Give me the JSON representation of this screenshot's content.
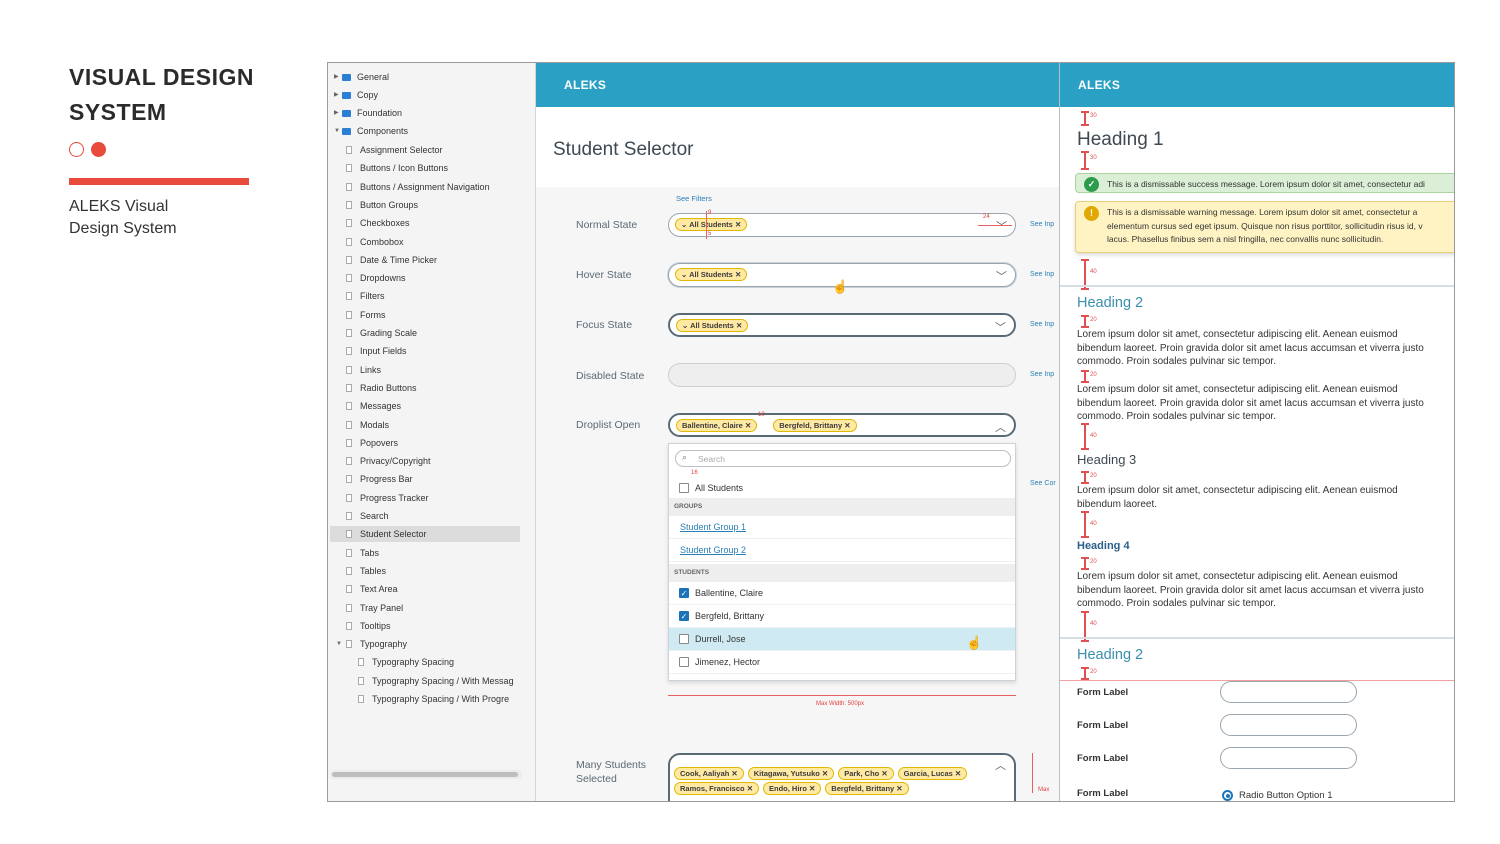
{
  "intro": {
    "title": "VISUAL DESIGN SYSTEM",
    "subtitle_line1": "ALEKS Visual",
    "subtitle_line2": "Design System",
    "accent_color": "#e84a3b"
  },
  "tree": {
    "folders": [
      "General",
      "Copy",
      "Foundation",
      "Components"
    ],
    "components": [
      "Assignment Selector",
      "Buttons / Icon Buttons",
      "Buttons / Assignment Navigation",
      "Button Groups",
      "Checkboxes",
      "Combobox",
      "Date & Time Picker",
      "Dropdowns",
      "Filters",
      "Forms",
      "Grading Scale",
      "Input Fields",
      "Links",
      "Radio Buttons",
      "Messages",
      "Modals",
      "Popovers",
      "Privacy/Copyright",
      "Progress Bar",
      "Progress Tracker",
      "Search",
      "Student Selector",
      "Tabs",
      "Tables",
      "Text Area",
      "Tray Panel",
      "Tooltips",
      "Typography"
    ],
    "typography_children": [
      "Typography Spacing",
      "Typography Spacing / With Messag",
      "Typography Spacing / With Progre"
    ],
    "selected": "Student Selector"
  },
  "mid": {
    "logo": "ALEKS",
    "title": "Student Selector",
    "see_filters": "See Filters",
    "states": {
      "normal": "Normal State",
      "hover": "Hover State",
      "focus": "Focus State",
      "disabled": "Disabled State",
      "droplist": "Droplist Open",
      "many_line1": "Many Students",
      "many_line2": "Selected"
    },
    "chip_all": "All Students",
    "see_inp": "See Inp",
    "see_cor": "See Cor",
    "open_chips": [
      "Ballentine, Claire",
      "Bergfeld, Brittany"
    ],
    "droplist": {
      "search_placeholder": "Search",
      "all_students": "All Students",
      "groups_header": "GROUPS",
      "groups": [
        "Student Group 1",
        "Student Group 2"
      ],
      "students_header": "STUDENTS",
      "students": [
        {
          "name": "Ballentine, Claire",
          "checked": true
        },
        {
          "name": "Bergfeld, Brittany",
          "checked": true
        },
        {
          "name": "Durrell, Jose",
          "checked": false
        },
        {
          "name": "Jimenez, Hector",
          "checked": false
        }
      ]
    },
    "max_width": "Max Width: 500px",
    "many_chips_row1": [
      "Cook, Aaliyah",
      "Kitagawa, Yutsuko",
      "Park, Cho",
      "Garcia, Lucas"
    ],
    "many_chips_row2": [
      "Ramos, Francisco",
      "Endo, Hiro",
      "Bergfeld, Brittany"
    ],
    "redlines": {
      "a": "5",
      "b": "9",
      "c": "24",
      "d": "10",
      "e": "16"
    },
    "max_short": "Max"
  },
  "right": {
    "logo": "ALEKS",
    "heading1": "Heading 1",
    "success_msg": "This is a dismissable success message. Lorem ipsum dolor sit amet, consectetur adi",
    "warning_line1": "This is a dismissable warning message. Lorem ipsum dolor sit amet, consectetur a",
    "warning_line2": "elementum cursus sed eget ipsum. Quisque non risus porttitor, sollicitudin risus id, v",
    "warning_line3": "lacus. Phasellus finibus sem a nisl fringilla, nec convallis nunc sollicitudin.",
    "heading2": "Heading 2",
    "heading3": "Heading 3",
    "heading4": "Heading 4",
    "lorem_long": "Lorem ipsum dolor sit amet, consectetur adipiscing elit. Aenean euismod bibendum laoreet. Proin gravida dolor sit amet lacus accumsan et viverra justo commodo. Proin sodales pulvinar sic tempor.",
    "lorem_short": "Lorem ipsum dolor sit amet, consectetur adipiscing elit. Aenean euismod bibendum laoreet.",
    "form_label": "Form Label",
    "radio_option": "Radio Button Option 1",
    "spacing": {
      "s30": "30",
      "s40": "40",
      "s20": "20"
    }
  }
}
